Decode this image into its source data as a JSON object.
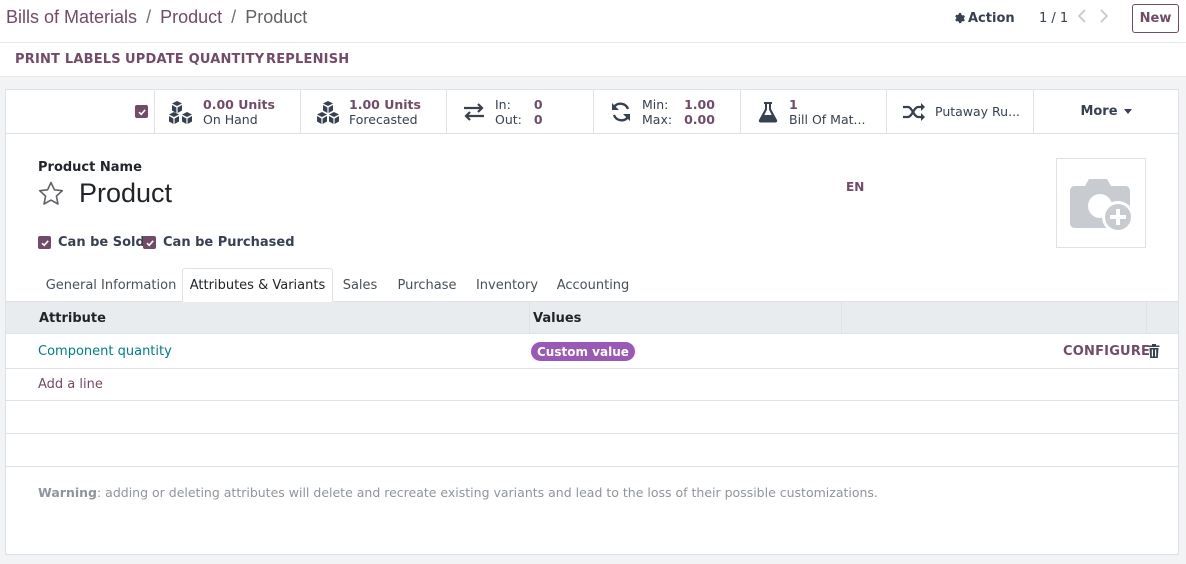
{
  "breadcrumb": {
    "part1": "Bills of Materials",
    "sep": "/",
    "part2": "Product",
    "current": "Product"
  },
  "toolbar": {
    "action_label": "Action",
    "pager": "1 / 1",
    "new_label": "New"
  },
  "header_buttons": {
    "print_labels": "PRINT LABELS",
    "update_quantity": "UPDATE QUANTITY",
    "replenish": "REPLENISH"
  },
  "stat_buttons": {
    "on_hand": {
      "value": "0.00 Units",
      "label": "On Hand"
    },
    "forecasted": {
      "value": "1.00 Units",
      "label": "Forecasted"
    },
    "in_out": {
      "in_label": "In:",
      "in_value": "0",
      "out_label": "Out:",
      "out_value": "0"
    },
    "minmax": {
      "min_label": "Min:",
      "min_value": "1.00",
      "max_label": "Max:",
      "max_value": "0.00"
    },
    "bom": {
      "value": "1",
      "label": "Bill Of Mat..."
    },
    "putaway": {
      "label": "Putaway Ru..."
    },
    "more": "More"
  },
  "form": {
    "product_name_label": "Product Name",
    "product_name": "Product",
    "lang": "EN",
    "can_be_sold": "Can be Sold",
    "can_be_purchased": "Can be Purchased"
  },
  "tabs": [
    "General Information",
    "Attributes & Variants",
    "Sales",
    "Purchase",
    "Inventory",
    "Accounting"
  ],
  "table": {
    "headers": {
      "attribute": "Attribute",
      "values": "Values"
    },
    "rows": [
      {
        "attribute": "Component quantity",
        "value_tag": "Custom value",
        "configure": "CONFIGURE"
      }
    ],
    "add_line": "Add a line"
  },
  "warning": {
    "label": "Warning",
    "text": ": adding or deleting attributes will delete and recreate existing variants and lead to the loss of their possible customizations."
  },
  "colors": {
    "brand": "#714b67",
    "link": "#017e84",
    "tag": "#9b59b6"
  },
  "icons": [
    "gear-icon",
    "chevron-left-icon",
    "chevron-right-icon",
    "cubes-icon",
    "exchange-icon",
    "refresh-icon",
    "flask-icon",
    "random-icon",
    "caret-down-icon",
    "star-icon",
    "camera-add-icon",
    "trash-icon",
    "checkbox-icon"
  ]
}
